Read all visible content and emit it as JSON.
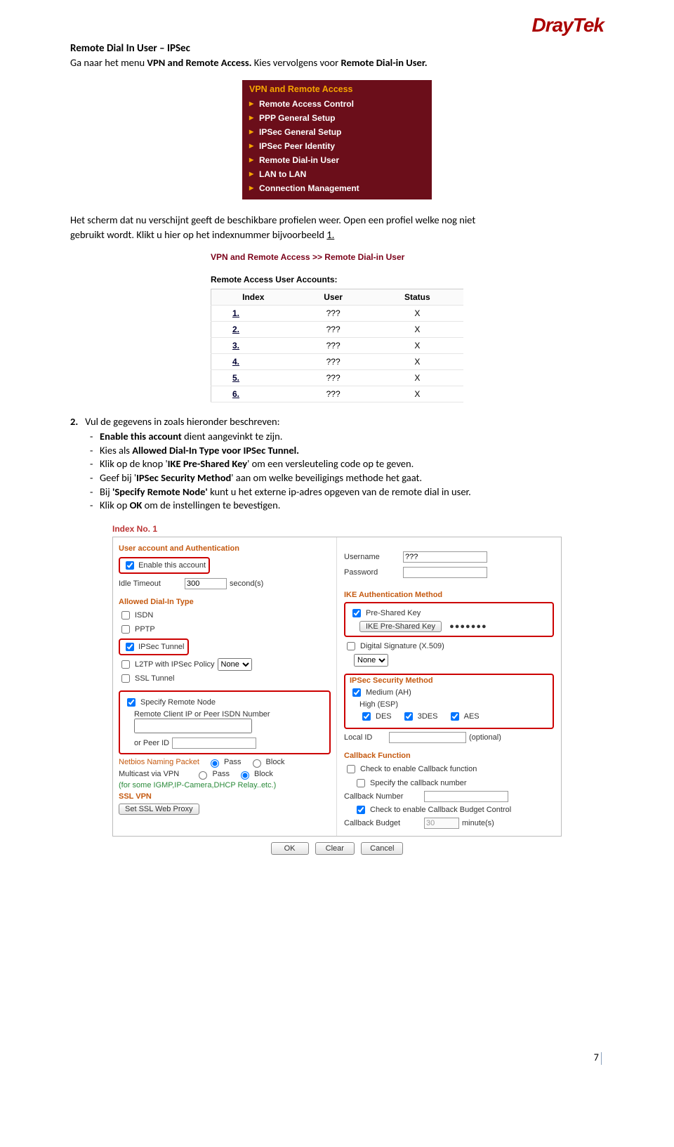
{
  "logo_text": "DrayTek",
  "title": "Remote Dial In User – IPSec",
  "intro_line_pre": "Ga naar het menu ",
  "intro_line_bold": "VPN and Remote Access.",
  "intro_line_post": " Kies vervolgens voor ",
  "intro_line_bold2": "Remote Dial-in User.",
  "menu": {
    "title": "VPN and Remote Access",
    "items": [
      "Remote Access Control",
      "PPP General Setup",
      "IPSec General Setup",
      "IPSec Peer Identity",
      "Remote Dial-in User",
      "LAN to LAN",
      "Connection Management"
    ]
  },
  "para2_a": "Het scherm dat nu verschijnt geeft de beschikbare profielen weer. Open een profiel welke nog niet",
  "para2_b": "gebruikt wordt. Klikt u hier op het indexnummer bijvoorbeeld  ",
  "para2_link": "1.",
  "accounts": {
    "breadcrumb": "VPN and Remote Access >> Remote Dial-in User",
    "subhead": "Remote Access User Accounts:",
    "cols": [
      "Index",
      "User",
      "Status"
    ],
    "rows": [
      {
        "idx": "1.",
        "user": "???",
        "status": "X"
      },
      {
        "idx": "2.",
        "user": "???",
        "status": "X"
      },
      {
        "idx": "3.",
        "user": "???",
        "status": "X"
      },
      {
        "idx": "4.",
        "user": "???",
        "status": "X"
      },
      {
        "idx": "5.",
        "user": "???",
        "status": "X"
      },
      {
        "idx": "6.",
        "user": "???",
        "status": "X"
      }
    ]
  },
  "step_num": "2.",
  "step_intro": "Vul de gegevens in zoals hieronder beschreven:",
  "bullets": {
    "b1_a": "Enable this account",
    "b1_b": " dient aangevinkt te zijn.",
    "b2_a": "Kies als ",
    "b2_b": "Allowed Dial-In Type voor IPSec Tunnel.",
    "b3_a": "Klik op de knop '",
    "b3_b": "IKE Pre-Shared Key",
    "b3_c": "' om een versleuteling code op te geven.",
    "b4_a": "Geef bij '",
    "b4_b": "IPSec Security Method",
    "b4_c": "' aan om welke beveiligings methode het gaat.",
    "b5_a": "Bij ",
    "b5_b": "'Specify Remote Node'",
    "b5_c": " kunt u het externe ip-adres opgeven van de remote dial in user.",
    "b6_a": "Klik op ",
    "b6_b": "OK",
    "b6_c": " om de instellingen te bevestigen."
  },
  "form": {
    "index_title": "Index No. 1",
    "left": {
      "head_user_acct": "User account and Authentication",
      "enable_this_account": "Enable this account",
      "idle_timeout_label": "Idle Timeout",
      "idle_timeout_value": "300",
      "idle_timeout_unit": "second(s)",
      "head_dialin": "Allowed Dial-In Type",
      "isdn": "ISDN",
      "pptp": "PPTP",
      "ipsec_tunnel": "IPSec Tunnel",
      "l2tp": "L2TP with IPSec Policy",
      "l2tp_sel": "None",
      "ssl_tunnel": "SSL Tunnel",
      "specify_remote": "Specify Remote Node",
      "remote_label": "Remote Client IP or Peer ISDN Number",
      "or_peer_id": "or Peer ID",
      "netbios_label": "Netbios Naming Packet",
      "pass": "Pass",
      "block": "Block",
      "multicast_label": "Multicast via VPN",
      "multicast_note": "(for some IGMP,IP-Camera,DHCP Relay..etc.)",
      "ssl_vpn_head": "SSL VPN",
      "set_ssl_btn": "Set SSL Web Proxy"
    },
    "right": {
      "username_label": "Username",
      "username_value": "???",
      "password_label": "Password",
      "ike_head": "IKE Authentication Method",
      "psk": "Pre-Shared Key",
      "ike_btn": "IKE Pre-Shared Key",
      "psk_dots": "●●●●●●●",
      "digsig": "Digital Signature (X.509)",
      "digsig_sel": "None",
      "sec_head": "IPSec Security Method",
      "medium": "Medium (AH)",
      "high": "High (ESP)",
      "des": "DES",
      "tdes": "3DES",
      "aes": "AES",
      "local_id_label": "Local ID",
      "optional": "(optional)",
      "callback_head": "Callback Function",
      "cb_enable": "Check to enable Callback function",
      "cb_specify": "Specify the callback number",
      "cb_number_label": "Callback Number",
      "cb_budget_enable": "Check to enable Callback Budget Control",
      "cb_budget_label": "Callback Budget",
      "cb_budget_value": "30",
      "cb_budget_unit": "minute(s)"
    },
    "buttons": {
      "ok": "OK",
      "clear": "Clear",
      "cancel": "Cancel"
    }
  },
  "page_number": "7"
}
